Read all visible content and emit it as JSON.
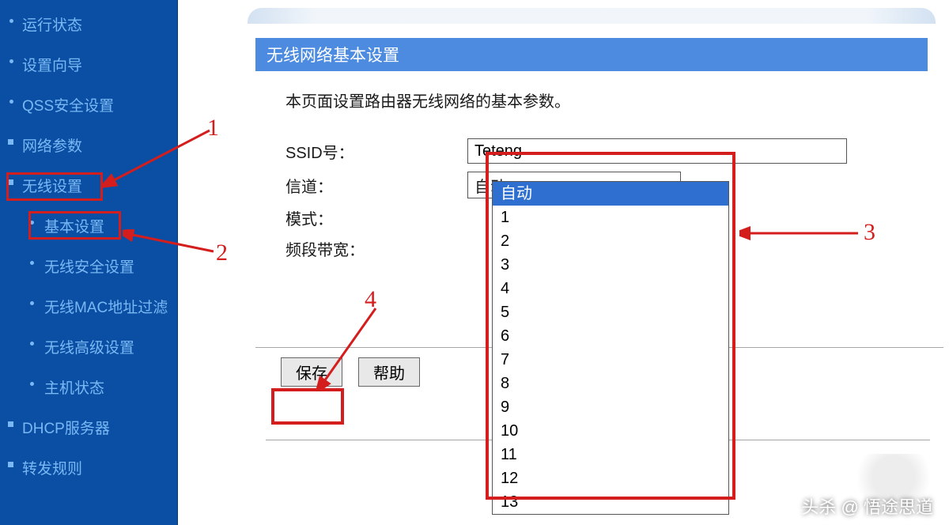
{
  "sidebar": {
    "items": [
      {
        "label": "运行状态",
        "type": "dot"
      },
      {
        "label": "设置向导",
        "type": "dot"
      },
      {
        "label": "QSS安全设置",
        "type": "dot"
      },
      {
        "label": "网络参数",
        "type": "plus"
      },
      {
        "label": "无线设置",
        "type": "minus"
      },
      {
        "label": "基本设置",
        "type": "sub"
      },
      {
        "label": "无线安全设置",
        "type": "sub"
      },
      {
        "label": "无线MAC地址过滤",
        "type": "sub"
      },
      {
        "label": "无线高级设置",
        "type": "sub"
      },
      {
        "label": "主机状态",
        "type": "sub"
      },
      {
        "label": "DHCP服务器",
        "type": "plus"
      },
      {
        "label": "转发规则",
        "type": "plus"
      }
    ]
  },
  "panel": {
    "title": "无线网络基本设置",
    "desc": "本页面设置路由器无线网络的基本参数。",
    "ssid_label": "SSID号：",
    "ssid_value": "Teteng",
    "channel_label": "信道：",
    "channel_value": "自动",
    "mode_label": "模式：",
    "bandwidth_label": "频段带宽：",
    "channel_options": [
      "自动",
      "1",
      "2",
      "3",
      "4",
      "5",
      "6",
      "7",
      "8",
      "9",
      "10",
      "11",
      "12",
      "13"
    ],
    "save_label": "保存",
    "help_label": "帮助"
  },
  "annotations": {
    "n1": "1",
    "n2": "2",
    "n3": "3",
    "n4": "4"
  },
  "watermark": "头杀 @ 悟途思道"
}
